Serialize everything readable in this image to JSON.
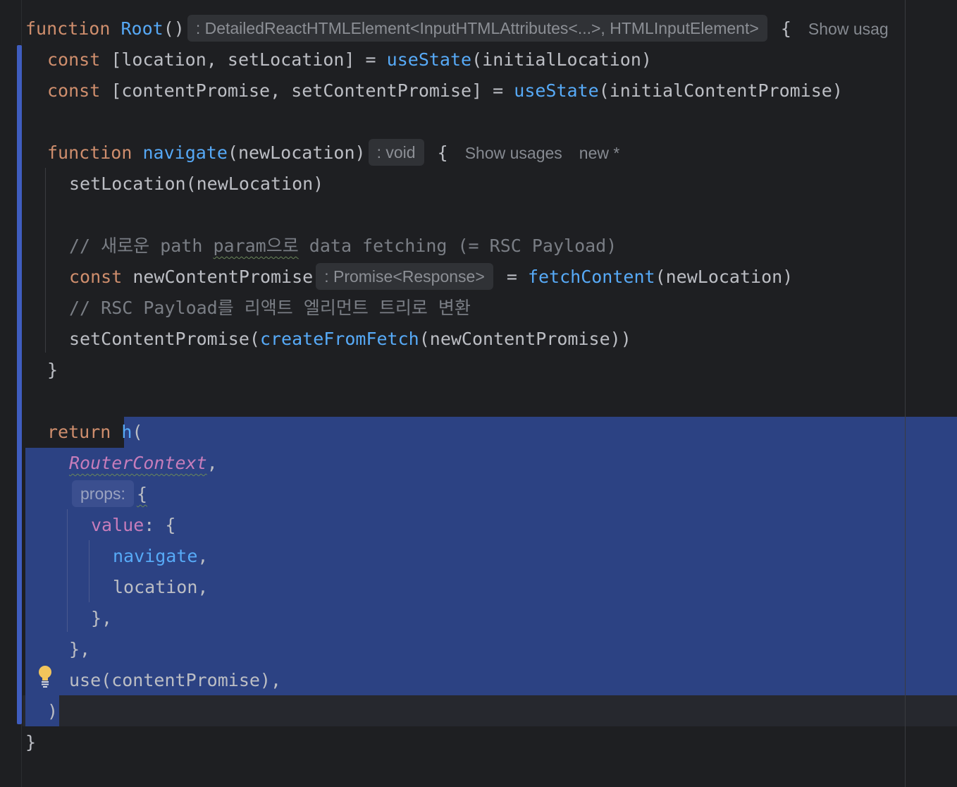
{
  "editor": {
    "lines": [
      {
        "function_kw": "function",
        "name": "Root",
        "parens": "()",
        "type_hint": ": DetailedReactHTMLElement<InputHTMLAttributes<...>, HTMLInputElement>",
        "brace": "{",
        "lens": "Show usag"
      },
      {
        "kw": "const",
        "pre": "[location, setLocation] = ",
        "fn": "useState",
        "post": "(initialLocation)"
      },
      {
        "kw": "const",
        "pre": "[contentPromise, setContentPromise] = ",
        "fn": "useState",
        "post": "(initialContentPromise)"
      },
      {
        "kw": "function",
        "fn": "navigate",
        "post": "(newLocation)",
        "type_hint": ": void",
        "brace": "{",
        "lens_usages": "Show usages",
        "lens_new": "new *"
      },
      {
        "text": "setLocation(newLocation)"
      },
      {
        "cmt_a": "// 새로운 path ",
        "cmt_b": "param으로",
        "cmt_c": " data fetching (= RSC Payload)"
      },
      {
        "kw": "const",
        "pre": "newContentPromise",
        "type_hint": ": Promise<Response>",
        "eq": "= ",
        "fn": "fetchContent",
        "post": "(newLocation)"
      },
      {
        "cmt": "// RSC Payload를 리액트 엘리먼트 트리로 변환"
      },
      {
        "pre": "setContentPromise(",
        "fn": "createFromFetch",
        "post": "(newContentPromise))"
      },
      {
        "text": "}"
      },
      {
        "kw": "return",
        "fn": "h",
        "post": "("
      },
      {
        "cls": "RouterContext",
        "post": ","
      },
      {
        "hint": "props:",
        "post": "{"
      },
      {
        "prop": "value",
        "post": ": {"
      },
      {
        "fn": "navigate",
        "post": ","
      },
      {
        "text": "location,"
      },
      {
        "text": "},"
      },
      {
        "text": "},"
      },
      {
        "text": "use(contentPromise),"
      },
      {
        "text": ")"
      },
      {
        "text": "}"
      }
    ],
    "icons": {
      "bulb": "lightbulb-icon"
    },
    "colors": {
      "background": "#1e1f22",
      "selection": "#2c4283",
      "keyword": "#cf8e6d",
      "function": "#56a8f5",
      "property": "#c77dbb",
      "comment": "#7a7e85"
    }
  }
}
